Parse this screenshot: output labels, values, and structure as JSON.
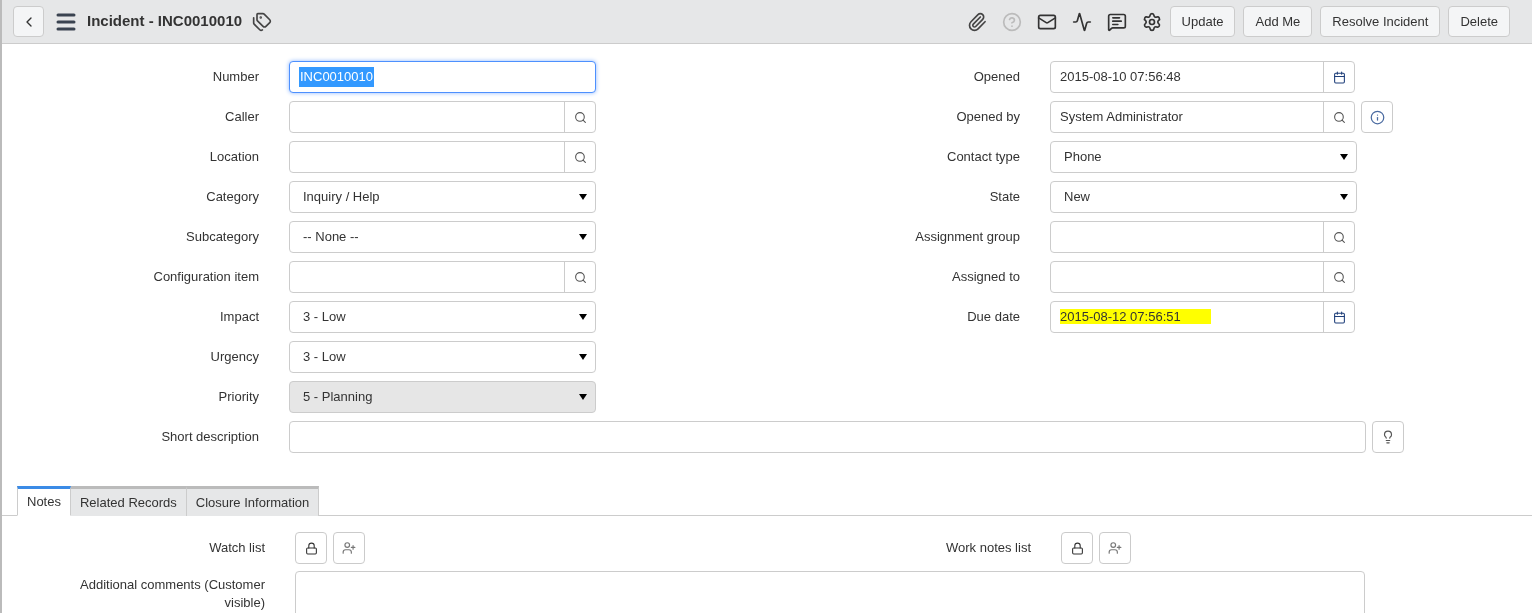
{
  "header": {
    "title": "Incident - INC0010010",
    "buttons": [
      "Update",
      "Add Me",
      "Resolve Incident",
      "Delete"
    ]
  },
  "left_fields": [
    {
      "label": "Number",
      "kind": "text",
      "value": "INC0010010",
      "focused": true,
      "highlighted": false,
      "disabled": false
    },
    {
      "label": "Caller",
      "kind": "lookup",
      "focused": false,
      "highlighted": false,
      "disabled": false
    },
    {
      "label": "Location",
      "kind": "lookup",
      "focused": false,
      "highlighted": false,
      "disabled": false
    },
    {
      "label": "Category",
      "kind": "select",
      "value": "Inquiry / Help",
      "focused": false,
      "highlighted": false,
      "disabled": false
    },
    {
      "label": "Subcategory",
      "kind": "select",
      "value": "-- None --",
      "focused": false,
      "highlighted": false,
      "disabled": false
    },
    {
      "label": "Configuration item",
      "kind": "lookup",
      "focused": false,
      "highlighted": false,
      "disabled": false
    },
    {
      "label": "Impact",
      "kind": "select",
      "value": "3 - Low",
      "focused": false,
      "highlighted": false,
      "disabled": false
    },
    {
      "label": "Urgency",
      "kind": "select",
      "value": "3 - Low",
      "focused": false,
      "highlighted": false,
      "disabled": false
    },
    {
      "label": "Priority",
      "kind": "select",
      "value": "5 - Planning",
      "focused": false,
      "highlighted": false,
      "disabled": true
    }
  ],
  "right_fields": [
    {
      "label": "Opened",
      "kind": "date",
      "value": "2015-08-10 07:56:48",
      "focused": false,
      "highlighted": false,
      "disabled": false
    },
    {
      "label": "Opened by",
      "kind": "lookup",
      "value": "System Administrator",
      "info_button": true,
      "focused": false,
      "highlighted": false,
      "disabled": false
    },
    {
      "label": "Contact type",
      "kind": "select",
      "value": "Phone",
      "focused": false,
      "highlighted": false,
      "disabled": false
    },
    {
      "label": "State",
      "kind": "select",
      "value": "New",
      "focused": false,
      "highlighted": false,
      "disabled": false
    },
    {
      "label": "Assignment group",
      "kind": "lookup",
      "focused": false,
      "highlighted": false,
      "disabled": false
    },
    {
      "label": "Assigned to",
      "kind": "lookup",
      "focused": false,
      "highlighted": false,
      "disabled": false
    },
    {
      "label": "Due date",
      "kind": "date",
      "value": "2015-08-12 07:56:51",
      "focused": false,
      "highlighted": true,
      "disabled": false
    }
  ],
  "short_description": {
    "label": "Short description"
  },
  "tabs": [
    {
      "label": "Notes",
      "selected": true
    },
    {
      "label": "Related Records",
      "selected": false
    },
    {
      "label": "Closure Information",
      "selected": false
    }
  ],
  "notes": {
    "watch_list": "Watch list",
    "work_notes_list": "Work notes list",
    "additional_comments": "Additional comments (Customer visible)"
  }
}
